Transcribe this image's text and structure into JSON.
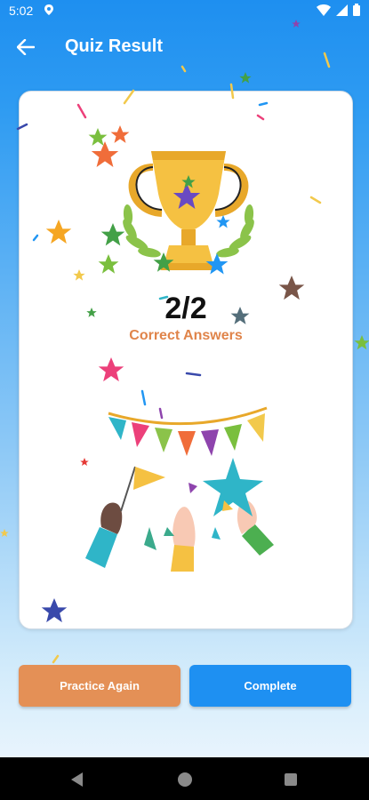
{
  "status_bar": {
    "time": "5:02"
  },
  "app_bar": {
    "title": "Quiz Result"
  },
  "result": {
    "score": "2/2",
    "label": "Correct Answers"
  },
  "buttons": {
    "practice": "Practice Again",
    "complete": "Complete"
  },
  "colors": {
    "primary": "#1E90F2",
    "accent_orange": "#E49056",
    "score_label": "#E0844A",
    "trophy": "#F5C142"
  },
  "icons": {
    "back": "arrow-left-icon",
    "wifi": "wifi-icon",
    "signal": "signal-icon",
    "battery": "battery-icon",
    "nav_back": "triangle-back-icon",
    "nav_home": "circle-home-icon",
    "nav_recents": "square-recents-icon"
  }
}
